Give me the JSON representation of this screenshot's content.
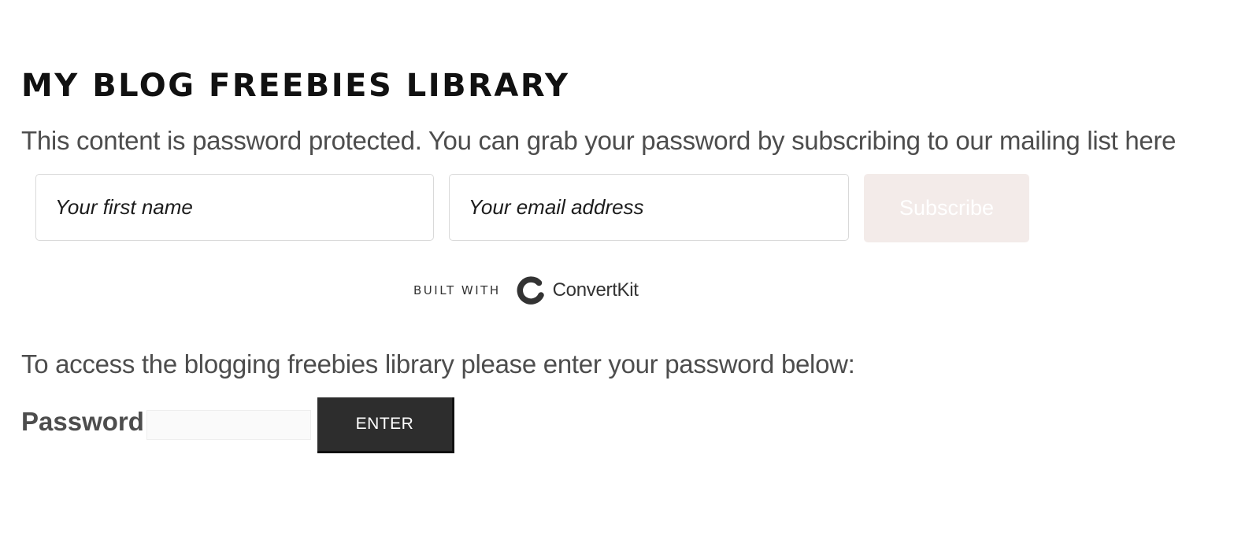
{
  "page": {
    "title": "MY BLOG FREEBIES LIBRARY",
    "intro_text": "This content is password protected. You can grab your password by subscribing to our mailing list here"
  },
  "subscribe_form": {
    "first_name_placeholder": "Your first name",
    "email_placeholder": "Your email address",
    "subscribe_label": "Subscribe",
    "subscribe_button_color": "#f3ebe9"
  },
  "branding": {
    "built_with_label": "BUILT WITH",
    "logo_text": "ConvertKit",
    "logo_icon": "convertkit-logo-icon"
  },
  "password_form": {
    "instructions": "To access the blogging freebies library please enter your password below:",
    "label": "Password:",
    "value": "",
    "enter_label": "ENTER",
    "enter_button_color": "#2d2d2d"
  }
}
